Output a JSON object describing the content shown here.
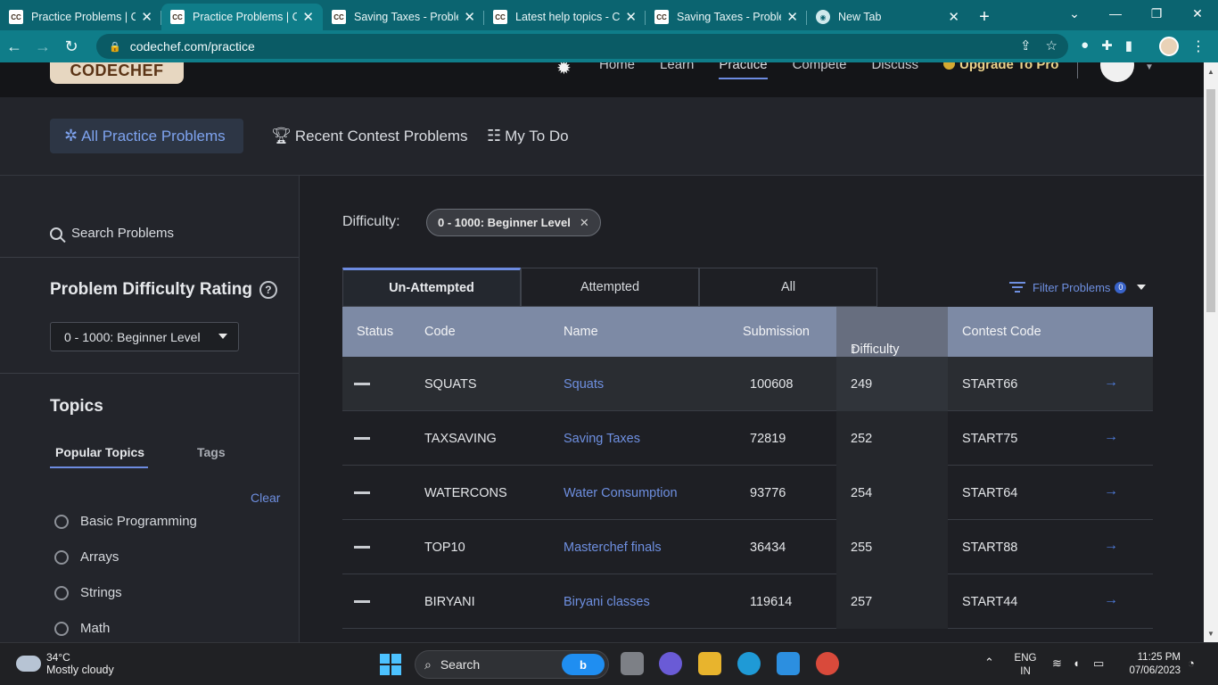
{
  "browser": {
    "tabs": [
      {
        "icon": "CC",
        "title": "Practice Problems | Co",
        "active": false
      },
      {
        "icon": "CC",
        "title": "Practice Problems | Co",
        "active": true
      },
      {
        "icon": "CC",
        "title": "Saving Taxes - Probler",
        "active": false
      },
      {
        "icon": "CC",
        "title": "Latest help topics - Co",
        "active": false
      },
      {
        "icon": "CC",
        "title": "Saving Taxes - Probler",
        "active": false
      },
      {
        "icon": "chrome",
        "title": "New Tab",
        "active": false
      }
    ],
    "url": "codechef.com/practice"
  },
  "site": {
    "logo": "CODECHEF",
    "nav": [
      "Home",
      "Learn",
      "Practice",
      "Compete",
      "Discuss"
    ],
    "active_nav": "Practice",
    "upgrade": "Upgrade To Pro"
  },
  "subnav": {
    "all": "All Practice Problems",
    "recent": "Recent Contest Problems",
    "todo": "My To Do"
  },
  "sidebar": {
    "search_label": "Search Problems",
    "rating_title": "Problem Difficulty Rating",
    "rating_selected": "0 - 1000: Beginner Level",
    "topics_title": "Topics",
    "topic_tabs": [
      "Popular Topics",
      "Tags"
    ],
    "clear": "Clear",
    "topics": [
      "Basic Programming",
      "Arrays",
      "Strings",
      "Math"
    ]
  },
  "main": {
    "difficulty_label": "Difficulty:",
    "difficulty_chip": "0 - 1000: Beginner Level",
    "segments": [
      "Un-Attempted",
      "Attempted",
      "All"
    ],
    "filter_label": "Filter Problems",
    "filter_count": "0",
    "columns": [
      "Status",
      "Code",
      "Name",
      "Submission",
      "Difficulty",
      "Contest Code"
    ],
    "rows": [
      {
        "code": "SQUATS",
        "name": "Squats",
        "submission": "100608",
        "difficulty": "249",
        "contest": "START66"
      },
      {
        "code": "TAXSAVING",
        "name": "Saving Taxes",
        "submission": "72819",
        "difficulty": "252",
        "contest": "START75"
      },
      {
        "code": "WATERCONS",
        "name": "Water Consumption",
        "submission": "93776",
        "difficulty": "254",
        "contest": "START64"
      },
      {
        "code": "TOP10",
        "name": "Masterchef finals",
        "submission": "36434",
        "difficulty": "255",
        "contest": "START88"
      },
      {
        "code": "BIRYANI",
        "name": "Biryani classes",
        "submission": "119614",
        "difficulty": "257",
        "contest": "START44"
      }
    ]
  },
  "taskbar": {
    "temp": "34°C",
    "weather": "Mostly cloudy",
    "search": "Search",
    "lang1": "ENG",
    "lang2": "IN",
    "time": "11:25 PM",
    "date": "07/06/2023"
  }
}
